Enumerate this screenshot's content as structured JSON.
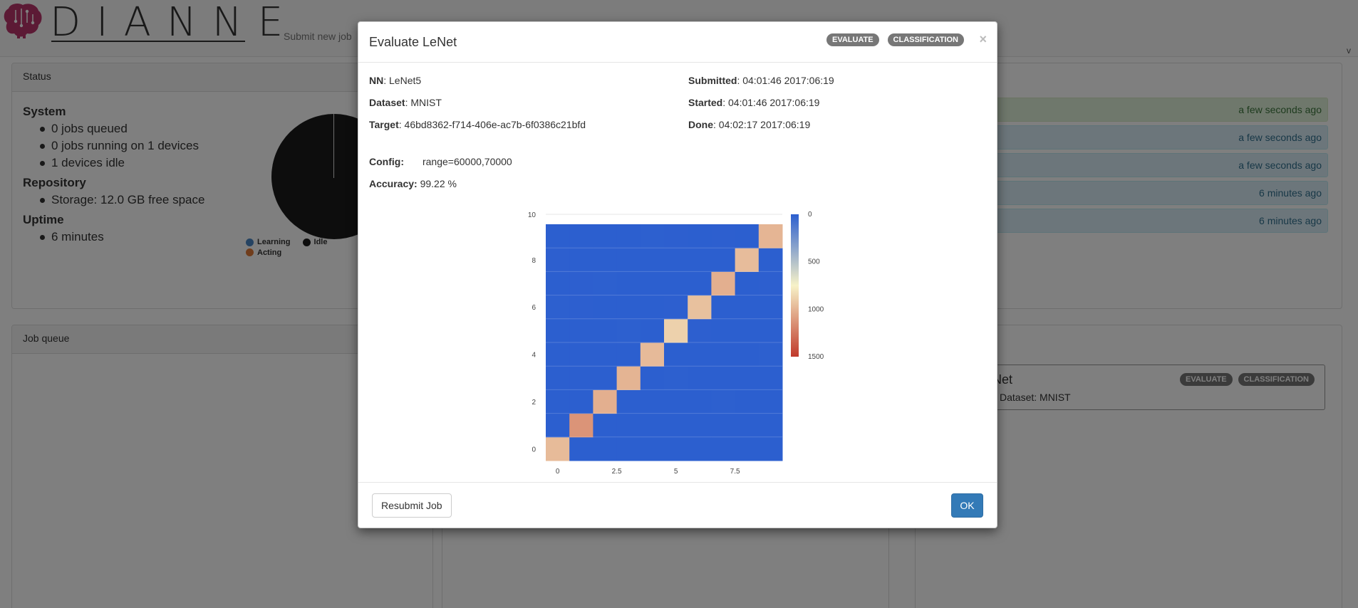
{
  "app": {
    "logo_text": "DIANNE",
    "nav_link": "Submit new job",
    "nav_caret": "v"
  },
  "status_panel": {
    "title": "Status",
    "system_heading": "System",
    "system_items": [
      "0 jobs queued",
      "0 jobs running on 1 devices",
      "1 devices idle"
    ],
    "repository_heading": "Repository",
    "repository_items": [
      "Storage: 12.0 GB free space"
    ],
    "uptime_heading": "Uptime",
    "uptime_items": [
      "6 minutes"
    ],
    "legend": [
      {
        "label": "Learning",
        "color": "#4a86c5"
      },
      {
        "label": "Idle",
        "color": "#1a1a1a"
      },
      {
        "label": "Acting",
        "color": "#e07b39"
      }
    ]
  },
  "notifications": [
    {
      "time": "a few seconds ago",
      "type": "success"
    },
    {
      "time": "a few seconds ago",
      "type": "info"
    },
    {
      "time": "a few seconds ago",
      "type": "info"
    },
    {
      "time": "6 minutes ago",
      "type": "info"
    },
    {
      "time": "6 minutes ago",
      "type": "info"
    }
  ],
  "job_queue": {
    "title": "Job queue"
  },
  "finished_job": {
    "title_fragment": "eNet",
    "dataset_fragment": "Dataset: MNIST",
    "badges": [
      "EVALUATE",
      "CLASSIFICATION"
    ]
  },
  "modal": {
    "title": "Evaluate LeNet",
    "badges": [
      "EVALUATE",
      "CLASSIFICATION"
    ],
    "close": "×",
    "nn_label": "NN",
    "nn_value": ": LeNet5",
    "dataset_label": "Dataset",
    "dataset_value": ": MNIST",
    "target_label": "Target",
    "target_value": ": 46bd8362-f714-406e-ac7b-6f0386c21bfd",
    "submitted_label": "Submitted",
    "submitted_value": ": 04:01:46 2017:06:19",
    "started_label": "Started",
    "started_value": ": 04:01:46 2017:06:19",
    "done_label": "Done",
    "done_value": ": 04:02:17 2017:06:19",
    "config_label": "Config:",
    "config_value": "range=60000,70000",
    "accuracy_label": "Accuracy:",
    "accuracy_value": "99.22 %",
    "resubmit_label": "Resubmit Job",
    "ok_label": "OK"
  },
  "chart_data": {
    "type": "heatmap",
    "x_ticks": [
      "0",
      "2.5",
      "5",
      "7.5"
    ],
    "y_ticks": [
      "0",
      "2",
      "4",
      "6",
      "8",
      "10"
    ],
    "colorbar_ticks": [
      "0",
      "500",
      "1000",
      "1500"
    ],
    "color_range": [
      0,
      1500
    ],
    "colors": [
      "#2c5fcf",
      "#f7f2c8",
      "#c0392b"
    ],
    "matrix": [
      [
        975,
        0,
        1,
        0,
        0,
        1,
        1,
        1,
        1,
        0
      ],
      [
        0,
        1132,
        1,
        0,
        0,
        0,
        1,
        1,
        0,
        0
      ],
      [
        1,
        1,
        1023,
        1,
        1,
        0,
        0,
        4,
        1,
        0
      ],
      [
        0,
        0,
        1,
        1003,
        0,
        3,
        0,
        1,
        1,
        1
      ],
      [
        0,
        0,
        0,
        0,
        976,
        0,
        1,
        0,
        0,
        5
      ],
      [
        1,
        0,
        0,
        4,
        0,
        884,
        2,
        0,
        1,
        0
      ],
      [
        3,
        2,
        0,
        0,
        1,
        2,
        949,
        0,
        1,
        0
      ],
      [
        0,
        2,
        3,
        0,
        0,
        0,
        0,
        1020,
        1,
        2
      ],
      [
        2,
        0,
        1,
        1,
        0,
        1,
        0,
        1,
        967,
        1
      ],
      [
        1,
        1,
        0,
        1,
        4,
        2,
        0,
        2,
        1,
        997
      ]
    ]
  }
}
